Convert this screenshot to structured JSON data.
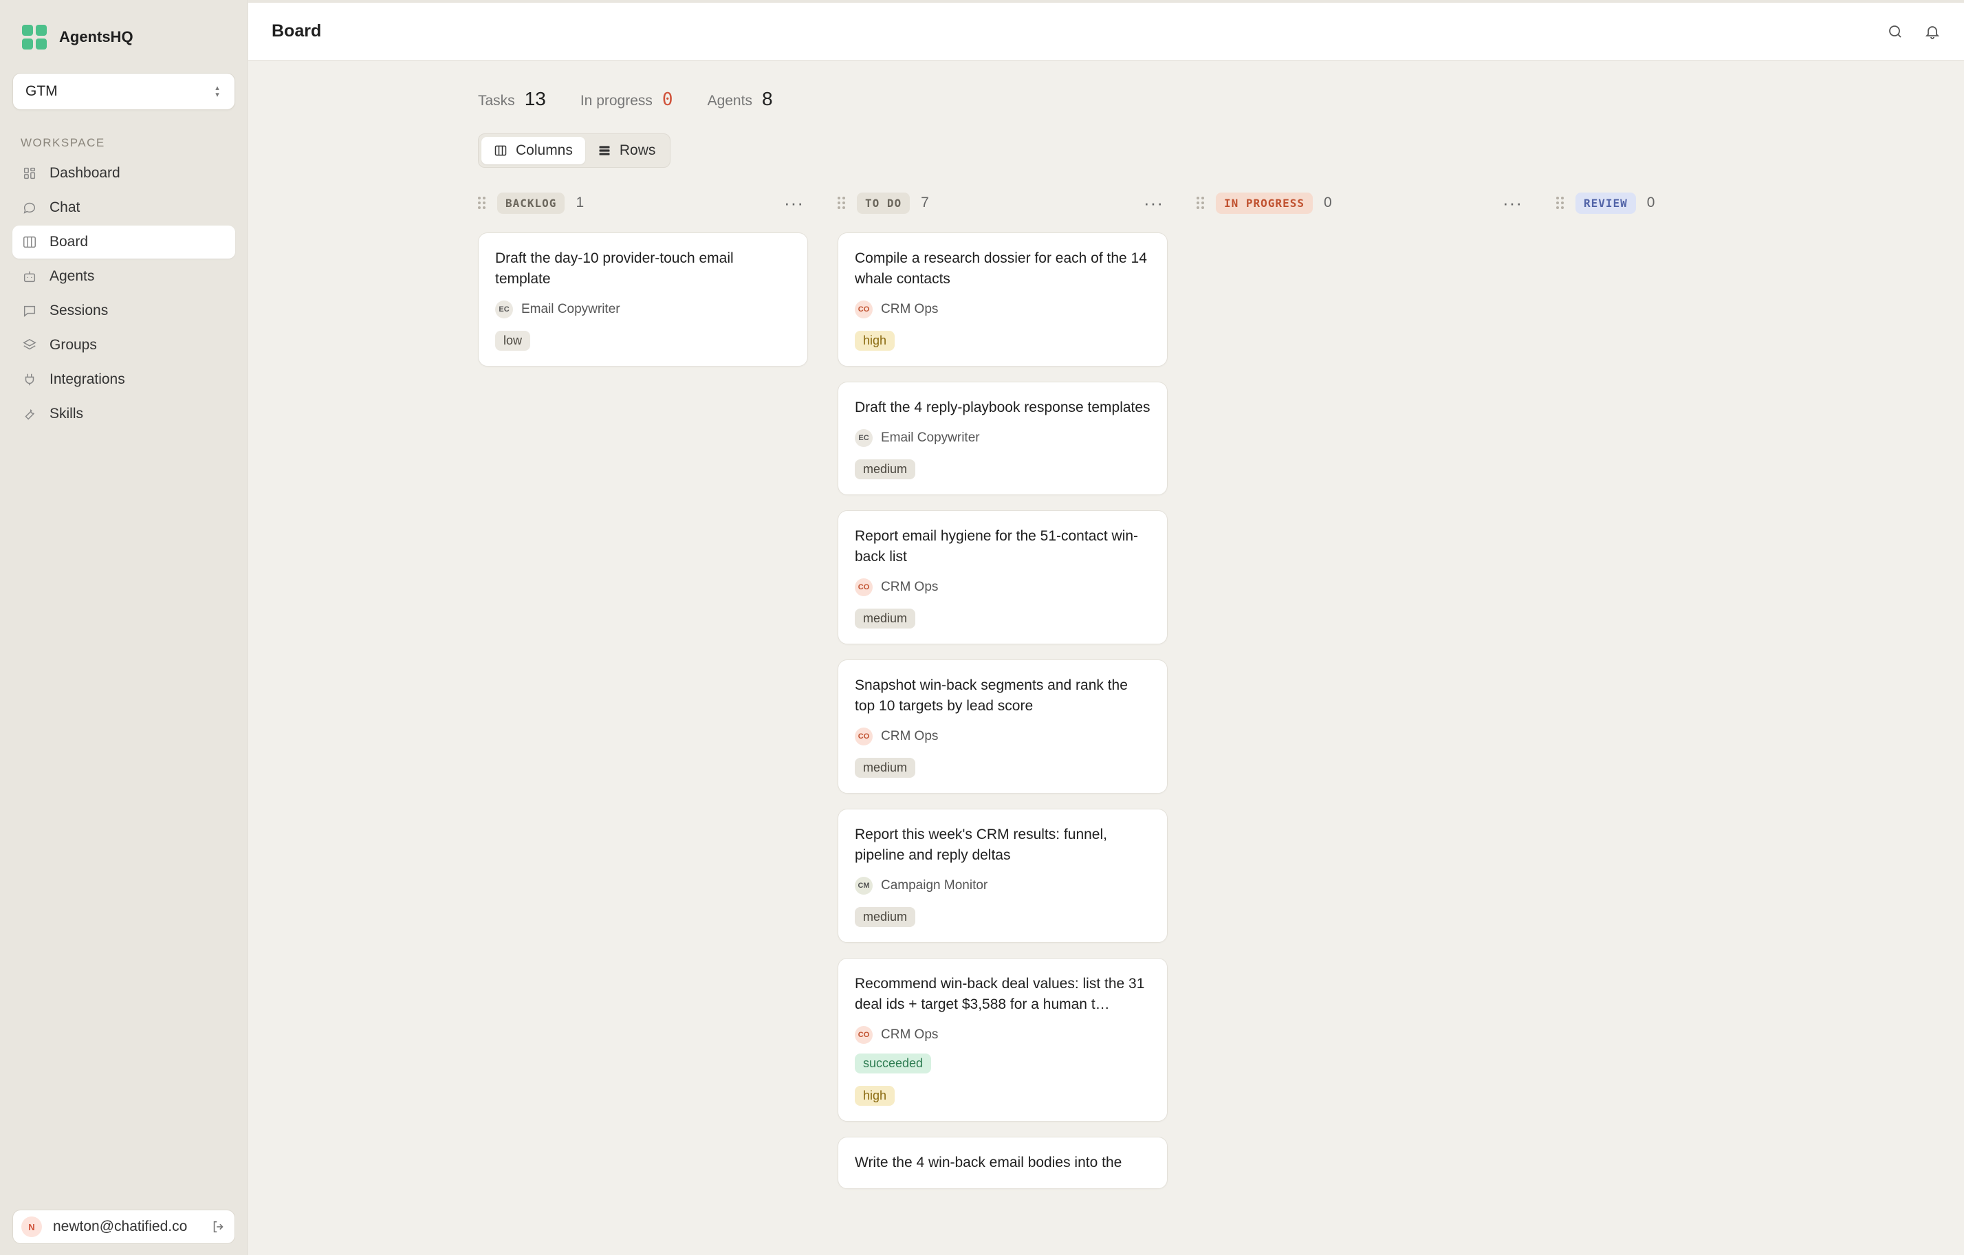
{
  "app": {
    "name": "AgentsHQ",
    "workspace": "GTM"
  },
  "sidebar": {
    "section": "WORKSPACE",
    "items": [
      {
        "label": "Dashboard",
        "icon": "grid-icon",
        "active": false
      },
      {
        "label": "Chat",
        "icon": "chat-icon",
        "active": false
      },
      {
        "label": "Board",
        "icon": "board-icon",
        "active": true
      },
      {
        "label": "Agents",
        "icon": "bot-icon",
        "active": false
      },
      {
        "label": "Sessions",
        "icon": "message-icon",
        "active": false
      },
      {
        "label": "Groups",
        "icon": "layers-icon",
        "active": false
      },
      {
        "label": "Integrations",
        "icon": "plug-icon",
        "active": false
      },
      {
        "label": "Skills",
        "icon": "wrench-icon",
        "active": false
      }
    ],
    "user": {
      "initial": "N",
      "email": "newton@chatified.co"
    }
  },
  "header": {
    "title": "Board"
  },
  "stats": {
    "tasks_label": "Tasks",
    "tasks": "13",
    "progress_label": "In progress",
    "progress": "0",
    "agents_label": "Agents",
    "agents": "8"
  },
  "view": {
    "columns_label": "Columns",
    "rows_label": "Rows",
    "selected": "Columns"
  },
  "columns": [
    {
      "name": "BACKLOG",
      "count": "1",
      "bg": "#e6e2d9",
      "fg": "#6b665c",
      "cards": [
        {
          "title": "Draft the day-10 provider-touch email template",
          "agent_ini": "EC",
          "agent": "Email Copywriter",
          "priority": "low",
          "status": null
        }
      ]
    },
    {
      "name": "TO DO",
      "count": "7",
      "bg": "#e6e2d9",
      "fg": "#6b665c",
      "cards": [
        {
          "title": "Compile a research dossier for each of the 14 whale contacts",
          "agent_ini": "CO",
          "agent": "CRM Ops",
          "priority": "high",
          "status": null
        },
        {
          "title": "Draft the 4 reply-playbook response templates",
          "agent_ini": "EC",
          "agent": "Email Copywriter",
          "priority": "medium",
          "status": null
        },
        {
          "title": "Report email hygiene for the 51-contact win-back list",
          "agent_ini": "CO",
          "agent": "CRM Ops",
          "priority": "medium",
          "status": null
        },
        {
          "title": "Snapshot win-back segments and rank the top 10 targets by lead score",
          "agent_ini": "CO",
          "agent": "CRM Ops",
          "priority": "medium",
          "status": null
        },
        {
          "title": "Report this week's CRM results: funnel, pipeline and reply deltas",
          "agent_ini": "CM",
          "agent": "Campaign Monitor",
          "priority": "medium",
          "status": null
        },
        {
          "title": "Recommend win-back deal values: list the 31 deal ids + target $3,588 for a human t…",
          "agent_ini": "CO",
          "agent": "CRM Ops",
          "priority": "high",
          "status": "succeeded"
        },
        {
          "title": "Write the 4 win-back email bodies into the",
          "agent_ini": "",
          "agent": "",
          "priority": "",
          "status": null
        }
      ]
    },
    {
      "name": "IN PROGRESS",
      "count": "0",
      "bg": "#f6dccf",
      "fg": "#c0512f",
      "cards": []
    },
    {
      "name": "REVIEW",
      "count": "0",
      "bg": "#dde3f6",
      "fg": "#5264a8",
      "cards": []
    }
  ],
  "colors": {
    "accent": "#4cc08a",
    "priority": {
      "low": "#ebe8e1",
      "medium": "#e7e4dc",
      "high": "#f7ecc6"
    },
    "status": {
      "succeeded": "#d7f1e1"
    },
    "agent_ini": {
      "EC": "#ebe8e1",
      "CO": "#fbe1d8",
      "CM": "#e7e9dc"
    }
  }
}
